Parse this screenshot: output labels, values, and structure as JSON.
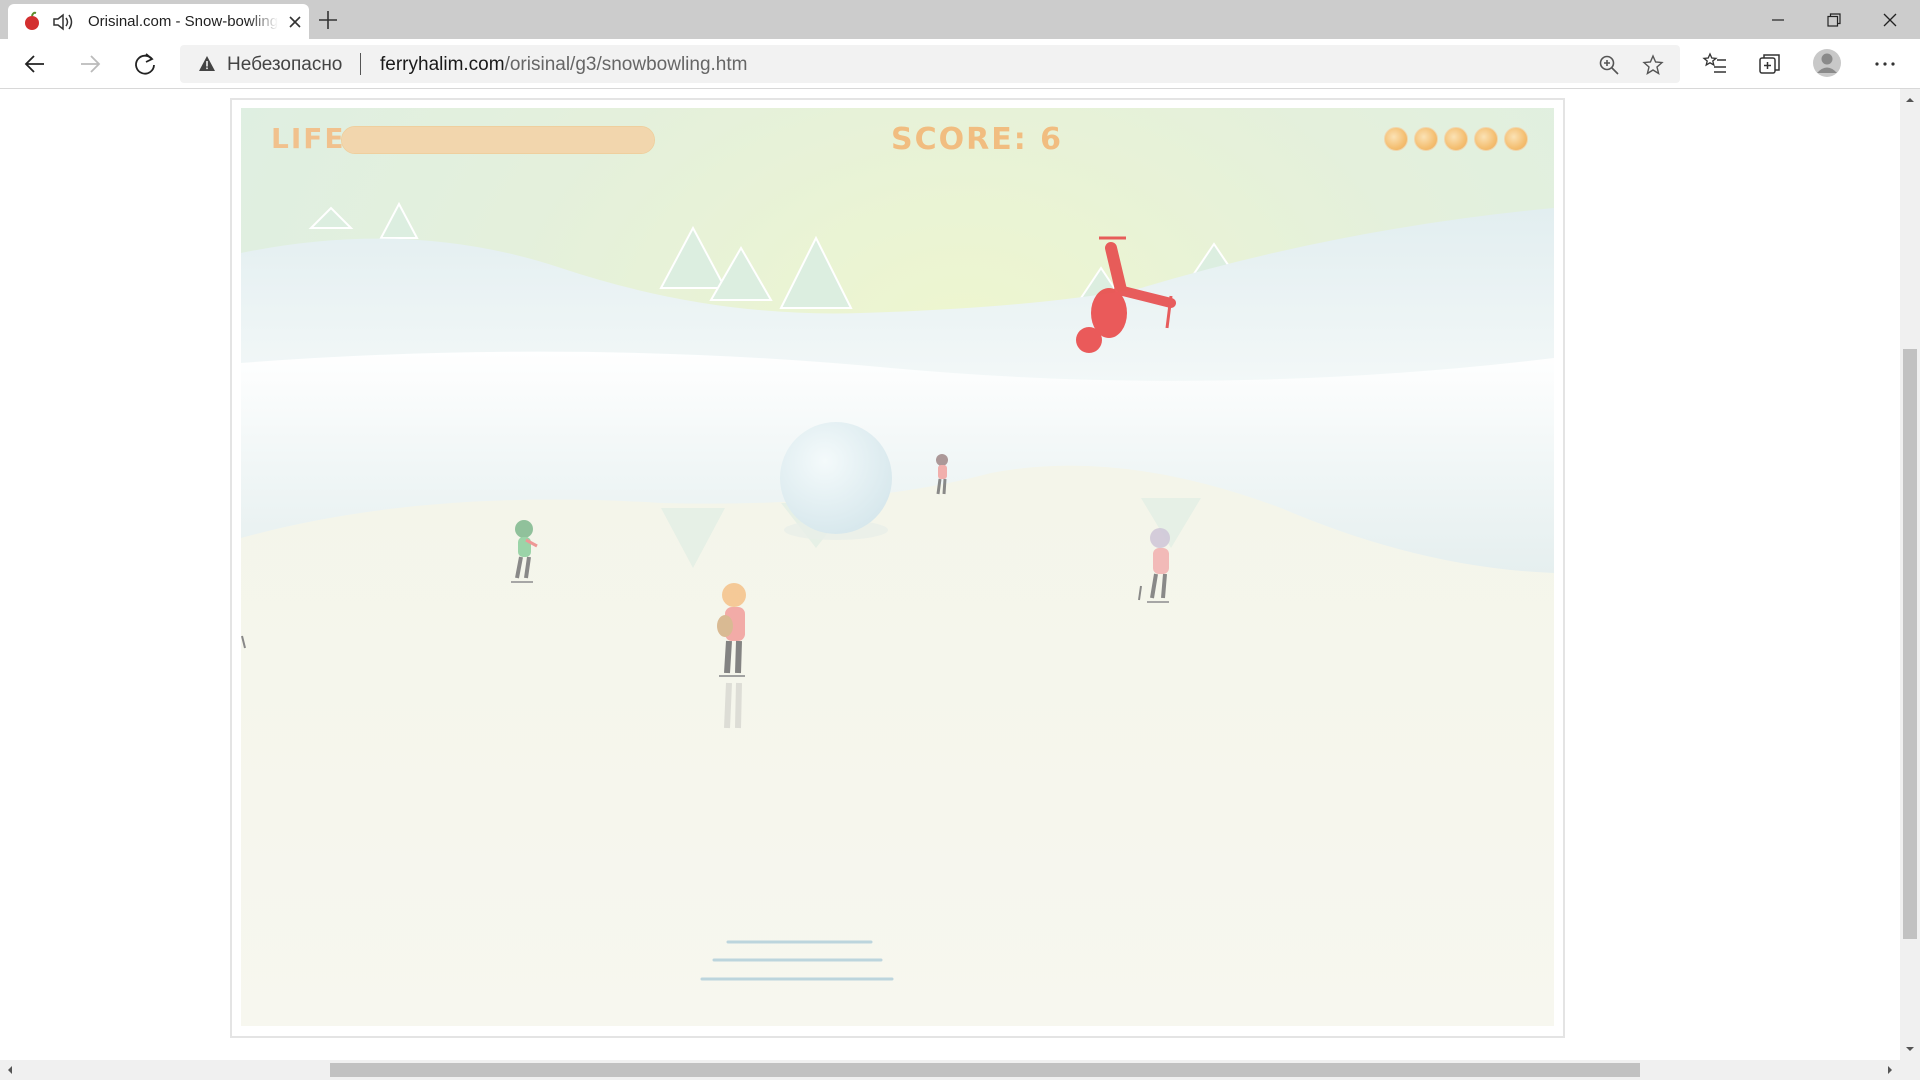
{
  "browser": {
    "tab": {
      "title": "Orisinal.com - Snow-bowling"
    },
    "address_bar": {
      "security_label": "Небезопасно",
      "url_domain": "ferryhalim.com",
      "url_path": "/orisinal/g3/snowbowling.htm"
    }
  },
  "game": {
    "hud": {
      "life_label": "LIFE:",
      "life_level": 1.0,
      "score_label": "SCORE:",
      "score_value": "6",
      "balls_remaining": 5
    }
  },
  "colors": {
    "hud_text": "#f1bd80",
    "life_bar": "#f5ddb8",
    "tab_strip": "#cccccc"
  }
}
